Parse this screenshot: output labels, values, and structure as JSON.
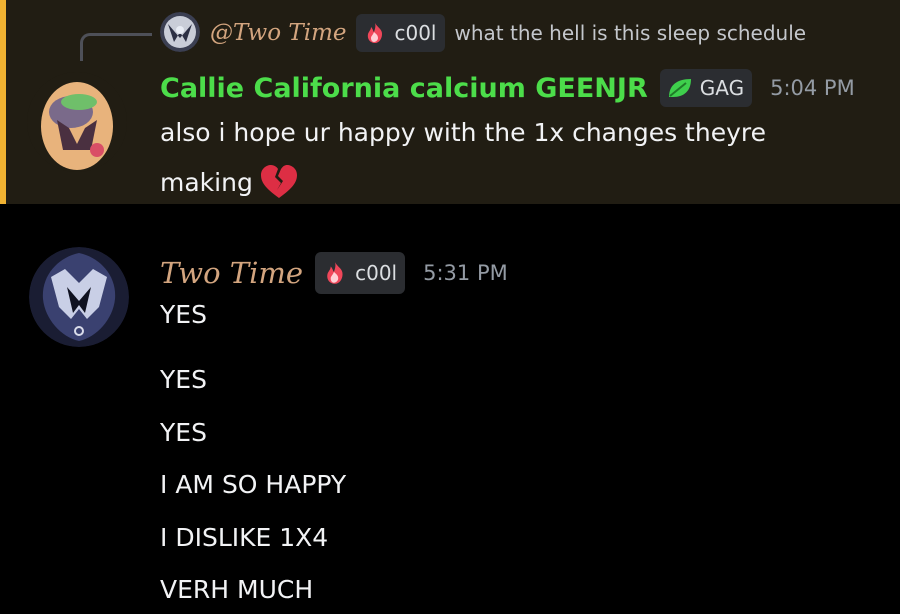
{
  "reply": {
    "name": "@Two Time",
    "tag": "c00l",
    "text": "what the hell is this sleep schedule"
  },
  "message1": {
    "author": "Callie California calcium GEENJR",
    "tag": "GAG",
    "time": "5:04 PM",
    "line1": "also i hope ur happy with the 1x changes theyre",
    "line2": "making",
    "emoji_name": "broken-heart-icon"
  },
  "message2": {
    "author": "Two Time",
    "tag": "c00l",
    "time": "5:31 PM",
    "lines": [
      "YES",
      "YES",
      "YES",
      "I AM SO HAPPY",
      "I DISLIKE 1X4",
      "VERH MUCH"
    ]
  },
  "colors": {
    "highlight_bg": "#211d13",
    "highlight_bar": "#f0b232",
    "green_author": "#4cdd4a",
    "gold_author": "#d3a57f",
    "timestamp": "#949ba4"
  }
}
